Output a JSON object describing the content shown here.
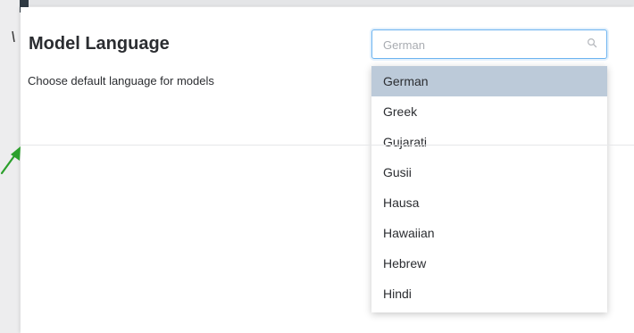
{
  "setting": {
    "title": "Model Language",
    "description": "Choose default language for models"
  },
  "language_select": {
    "search_value": "German",
    "search_icon": "search-icon",
    "selected": "German",
    "options": [
      {
        "label": "German",
        "selected": true
      },
      {
        "label": "Greek",
        "selected": false
      },
      {
        "label": "Gujarati",
        "selected": false
      },
      {
        "label": "Gusii",
        "selected": false
      },
      {
        "label": "Hausa",
        "selected": false
      },
      {
        "label": "Hawaiian",
        "selected": false
      },
      {
        "label": "Hebrew",
        "selected": false
      },
      {
        "label": "Hindi",
        "selected": false
      }
    ]
  },
  "colors": {
    "focus_border": "#6cb3f0",
    "selected_option_bg": "#bccad9",
    "annotation_arrow": "#2ca02c"
  }
}
